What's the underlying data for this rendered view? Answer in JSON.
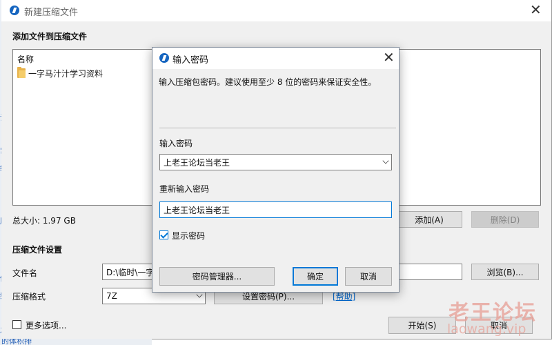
{
  "main_window": {
    "title": "新建压缩文件",
    "add_files_label": "添加文件到压缩文件",
    "column_name": "名称",
    "files": [
      {
        "name": "一字马汁汁学习资料"
      }
    ],
    "total_size": "总大小: 1.97 GB",
    "add_button": "添加(A)",
    "delete_button": "删除(D)",
    "settings_label": "压缩文件设置",
    "filename_label": "文件名",
    "filename_value": "D:\\临时\\一字",
    "browse_button": "浏览(B)...",
    "format_label": "压缩格式",
    "format_value": "7Z",
    "set_password_button": "设置密码(P)...",
    "help_link": "[帮助]",
    "more_options_label": "更多选项...",
    "start_button": "开始(S)",
    "cancel_button": "取消"
  },
  "password_dialog": {
    "title": "输入密码",
    "description": "输入压缩包密码。建议使用至少 8 位的密码来保证安全性。",
    "password_label": "输入密码",
    "password_value": "上老王论坛当老王",
    "reenter_label": "重新输入密码",
    "reenter_value": "上老王论坛当老王",
    "show_password_label": "显示密码",
    "show_password_checked": true,
    "manager_button": "密码管理器...",
    "ok_button": "确定",
    "cancel_button": "取消"
  },
  "watermark": {
    "cn": "老王论坛",
    "en": "laowang.vip"
  },
  "colors": {
    "accent": "#0078d7",
    "app_icon": "#1565c0",
    "folder": "#e8b24a",
    "link": "#0066cc"
  }
}
